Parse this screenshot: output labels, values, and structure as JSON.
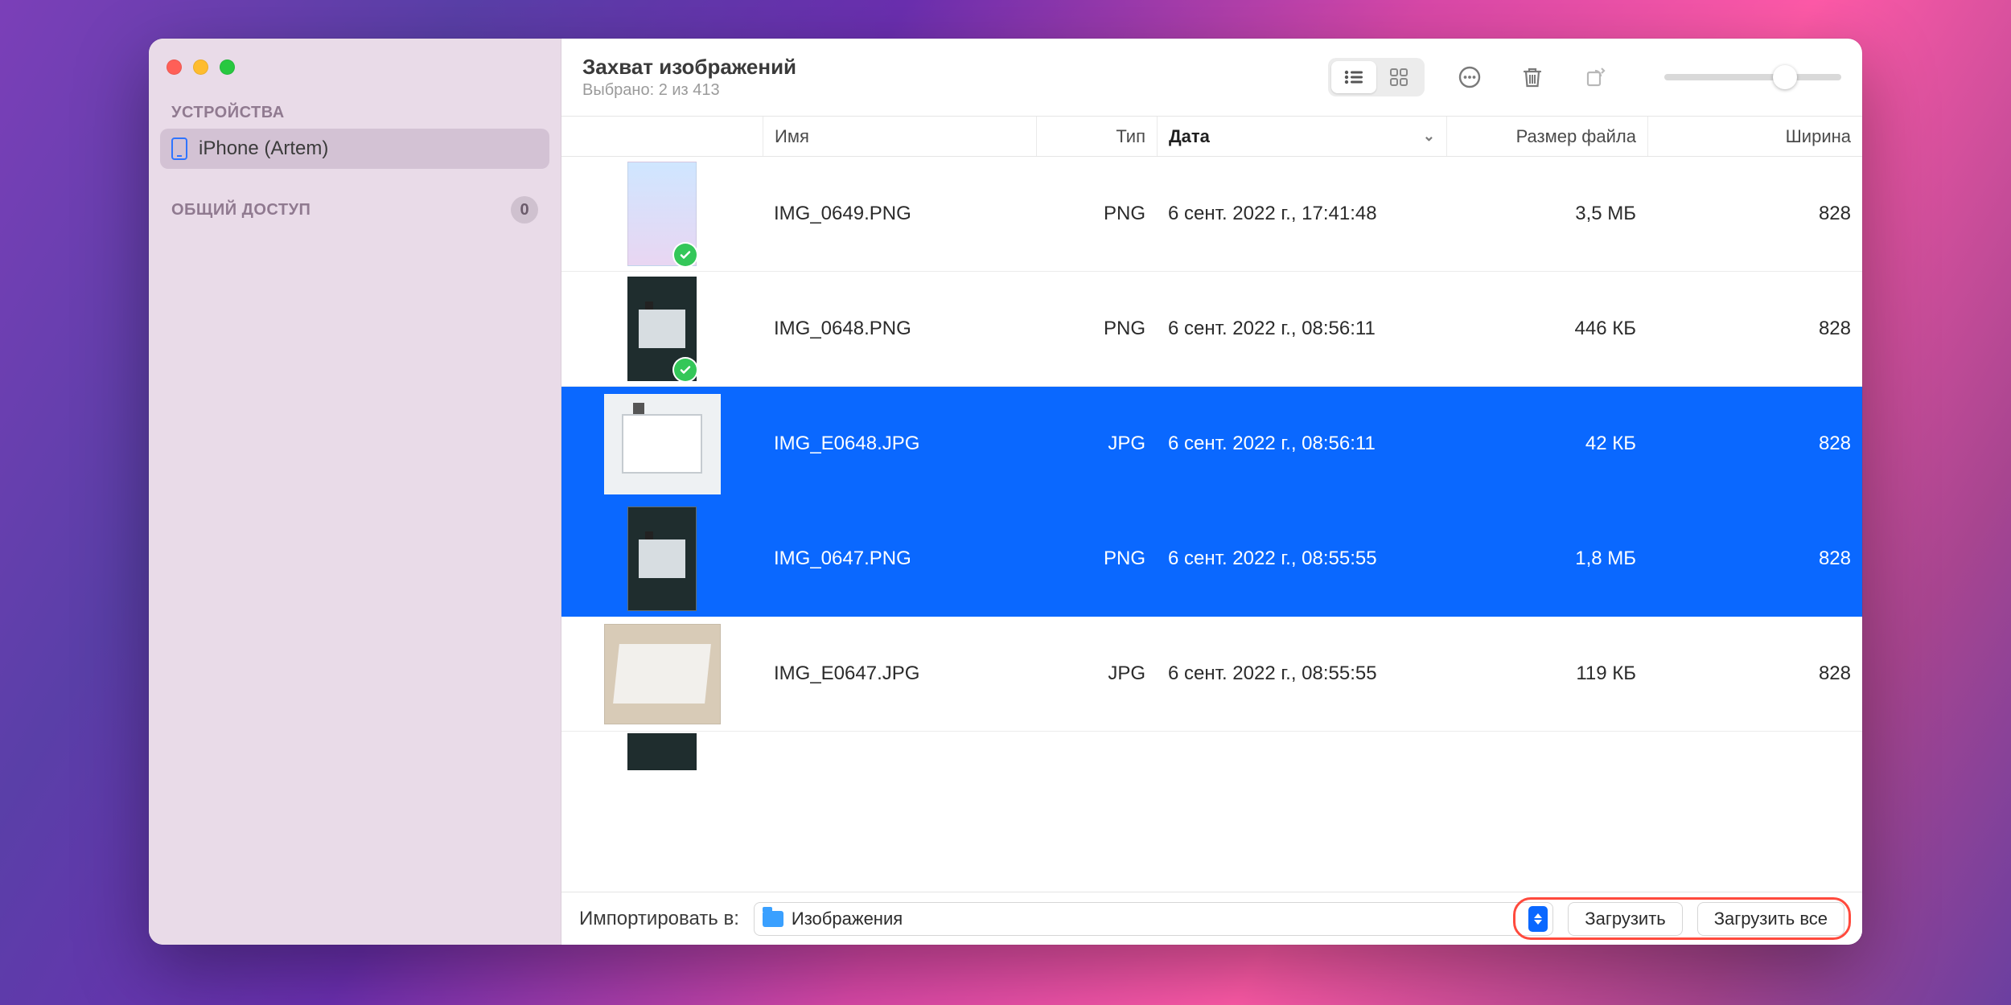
{
  "app": {
    "title": "Захват изображений",
    "subtitle": "Выбрано: 2 из 413"
  },
  "sidebar": {
    "sections": {
      "devices_label": "УСТРОЙСТВА",
      "shared_label": "ОБЩИЙ ДОСТУП",
      "shared_count": "0",
      "device_name": "iPhone (Artem)"
    }
  },
  "columns": {
    "name": "Имя",
    "type": "Тип",
    "date": "Дата",
    "size": "Размер файла",
    "width": "Ширина"
  },
  "rows": [
    {
      "name": "IMG_0649.PNG",
      "type": "PNG",
      "date": "6 сент. 2022 г., 17:41:48",
      "size": "3,5 МБ",
      "width": "828",
      "selected": false,
      "imported": true,
      "thumb": "phone"
    },
    {
      "name": "IMG_0648.PNG",
      "type": "PNG",
      "date": "6 сент. 2022 г., 08:56:11",
      "size": "446 КБ",
      "width": "828",
      "selected": false,
      "imported": true,
      "thumb": "desk-dark"
    },
    {
      "name": "IMG_E0648.JPG",
      "type": "JPG",
      "date": "6 сент. 2022 г., 08:56:11",
      "size": "42 КБ",
      "width": "828",
      "selected": true,
      "imported": false,
      "thumb": "desk-wide"
    },
    {
      "name": "IMG_0647.PNG",
      "type": "PNG",
      "date": "6 сент. 2022 г., 08:55:55",
      "size": "1,8 МБ",
      "width": "828",
      "selected": true,
      "imported": false,
      "thumb": "desk-dark"
    },
    {
      "name": "IMG_E0647.JPG",
      "type": "JPG",
      "date": "6 сент. 2022 г., 08:55:55",
      "size": "119 КБ",
      "width": "828",
      "selected": false,
      "imported": false,
      "thumb": "desk-photo"
    }
  ],
  "footer": {
    "import_to_label": "Импортировать в:",
    "destination": "Изображения",
    "download": "Загрузить",
    "download_all": "Загрузить все"
  }
}
